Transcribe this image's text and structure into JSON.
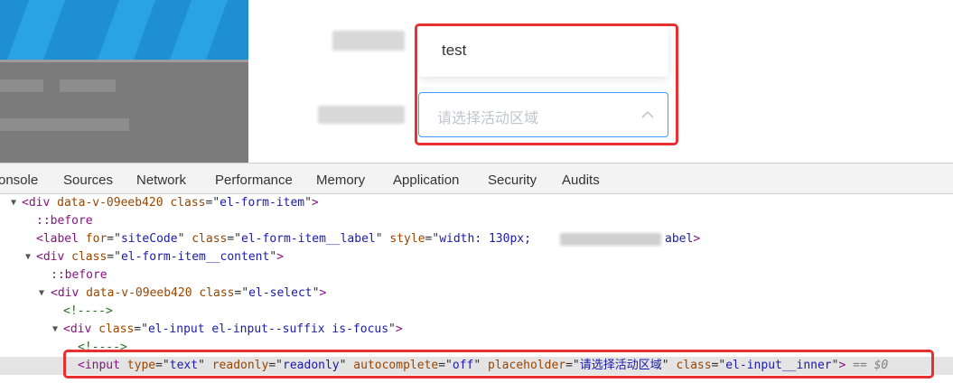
{
  "form": {
    "test_value": "test",
    "select_placeholder": "请选择活动区域"
  },
  "devtools": {
    "tabs": [
      "onsole",
      "Sources",
      "Network",
      "Performance",
      "Memory",
      "Application",
      "Security",
      "Audits"
    ]
  },
  "dom": {
    "l1": {
      "tag_open": "<div",
      "a1": "data-v-09eeb420",
      "a2": "class",
      "v2": "el-form-item",
      "tag_close": ">"
    },
    "l2": {
      "pseudo": "::before"
    },
    "l3": {
      "tag_open": "<label",
      "a1": "for",
      "v1": "siteCode",
      "a2": "class",
      "v2": "el-form-item__label",
      "a3": "style",
      "v3_start": "width: 130px;",
      "v3_end": "abel",
      "tag_close": ">"
    },
    "l4": {
      "tag_open": "<div",
      "a1": "class",
      "v1": "el-form-item__content",
      "tag_close": ">"
    },
    "l5": {
      "pseudo": "::before"
    },
    "l6": {
      "tag_open": "<div",
      "a1": "data-v-09eeb420",
      "a2": "class",
      "v2": "el-select",
      "tag_close": ">"
    },
    "l7": {
      "comment": "<!---->"
    },
    "l8": {
      "tag_open": "<div",
      "a1": "class",
      "v1": "el-input el-input--suffix is-focus",
      "tag_close": ">"
    },
    "l9": {
      "comment": "<!---->"
    },
    "l10": {
      "tag_open": "<input",
      "a1": "type",
      "v1": "text",
      "a2": "readonly",
      "v2": "readonly",
      "a3": "autocomplete",
      "v3": "off",
      "a4": "placeholder",
      "v4": "请选择活动区域",
      "a5": "class",
      "v5": "el-input__inner",
      "tag_close": ">",
      "eq": "==",
      "dollar": "$0"
    }
  }
}
